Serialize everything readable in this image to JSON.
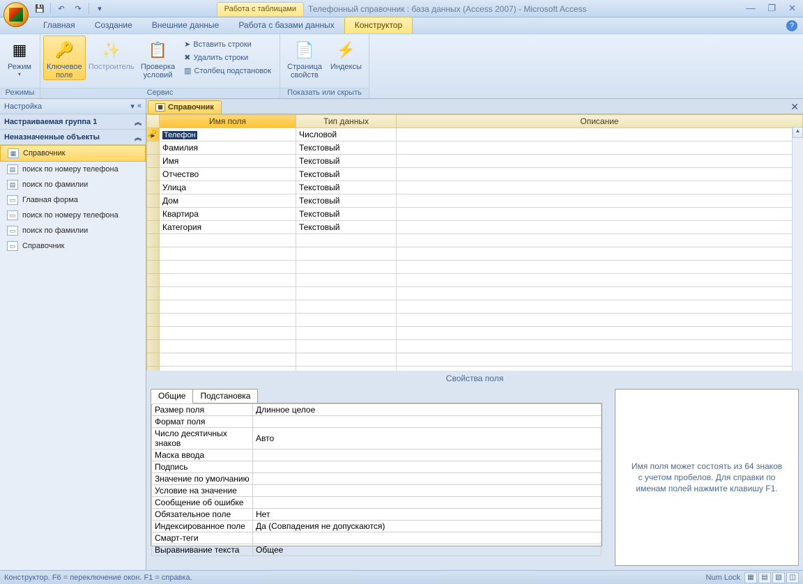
{
  "title": {
    "contextual_label": "Работа с таблицами",
    "app_title": "Телефонный справочник : база данных (Access 2007) - Microsoft Access"
  },
  "tabs": {
    "home": "Главная",
    "create": "Создание",
    "external": "Внешние данные",
    "dbtools": "Работа с базами данных",
    "design": "Конструктор"
  },
  "ribbon": {
    "modes_group": "Режимы",
    "mode_btn": "Режим",
    "key_field": "Ключевое\nполе",
    "builder": "Построитель",
    "test_rules": "Проверка\nусловий",
    "insert_rows": "Вставить строки",
    "delete_rows": "Удалить строки",
    "lookup_col": "Столбец подстановок",
    "service_group": "Сервис",
    "prop_sheet": "Страница\nсвойств",
    "indexes": "Индексы",
    "show_hide_group": "Показать или скрыть"
  },
  "nav": {
    "header": "Настройка",
    "group1": "Настраиваемая группа 1",
    "group2": "Неназначенные объекты",
    "items": [
      {
        "label": "Справочник",
        "icon": "table",
        "selected": true
      },
      {
        "label": "поиск по номеру телефона",
        "icon": "query"
      },
      {
        "label": "поиск по фамилии",
        "icon": "query"
      },
      {
        "label": "Главная форма",
        "icon": "form"
      },
      {
        "label": "поиск по номеру телефона",
        "icon": "form"
      },
      {
        "label": "поиск по фамилии",
        "icon": "form"
      },
      {
        "label": "Справочник",
        "icon": "form"
      }
    ]
  },
  "doc_tab": "Справочник",
  "grid": {
    "col_name": "Имя поля",
    "col_type": "Тип данных",
    "col_desc": "Описание",
    "rows": [
      {
        "key": true,
        "selected": true,
        "name": "Телефон",
        "type": "Числовой"
      },
      {
        "name": "Фамилия",
        "type": "Текстовый"
      },
      {
        "name": "Имя",
        "type": "Текстовый"
      },
      {
        "name": "Отчество",
        "type": "Текстовый"
      },
      {
        "name": "Улица",
        "type": "Текстовый"
      },
      {
        "name": "Дом",
        "type": "Текстовый"
      },
      {
        "name": "Квартира",
        "type": "Текстовый"
      },
      {
        "name": "Категория",
        "type": "Текстовый"
      }
    ]
  },
  "props": {
    "section_label": "Свойства поля",
    "tab_general": "Общие",
    "tab_lookup": "Подстановка",
    "rows": [
      {
        "k": "Размер поля",
        "v": "Длинное целое"
      },
      {
        "k": "Формат поля",
        "v": ""
      },
      {
        "k": "Число десятичных знаков",
        "v": "Авто"
      },
      {
        "k": "Маска ввода",
        "v": ""
      },
      {
        "k": "Подпись",
        "v": ""
      },
      {
        "k": "Значение по умолчанию",
        "v": ""
      },
      {
        "k": "Условие на значение",
        "v": ""
      },
      {
        "k": "Сообщение об ошибке",
        "v": ""
      },
      {
        "k": "Обязательное поле",
        "v": "Нет"
      },
      {
        "k": "Индексированное поле",
        "v": "Да (Совпадения не допускаются)"
      },
      {
        "k": "Смарт-теги",
        "v": ""
      },
      {
        "k": "Выравнивание текста",
        "v": "Общее"
      }
    ],
    "hint": "Имя поля может состоять из 64 знаков с учетом пробелов.  Для справки по именам полей нажмите клавишу F1."
  },
  "status": {
    "left": "Конструктор.  F6 = переключение окон.  F1 = справка.",
    "numlock": "Num Lock"
  }
}
